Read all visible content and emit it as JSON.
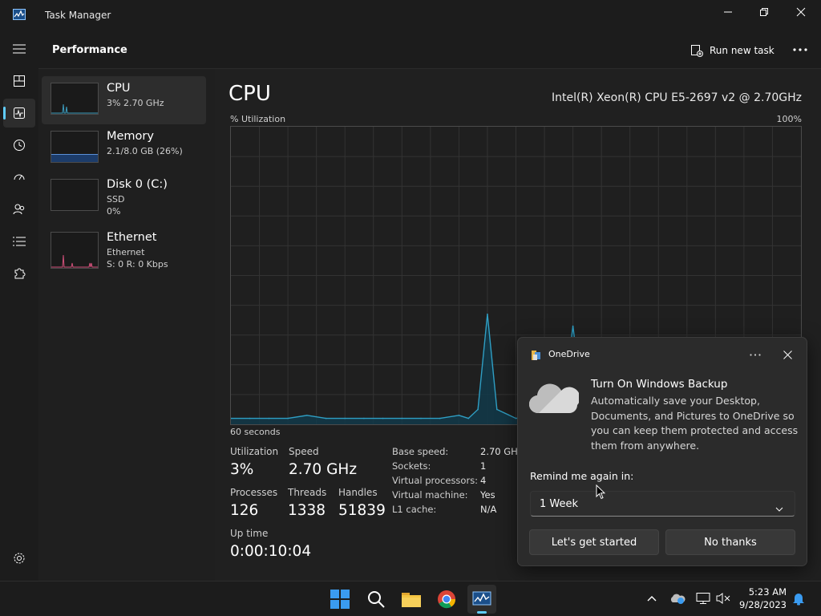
{
  "window": {
    "title": "Task Manager"
  },
  "header": {
    "page_title": "Performance",
    "run_new_task_label": "Run new task"
  },
  "devices": [
    {
      "name": "CPU",
      "sub1": "3% 2.70 GHz",
      "sub2": "",
      "sub3": "",
      "graph_color": "#3c9dbf"
    },
    {
      "name": "Memory",
      "sub1": "2.1/8.0 GB (26%)",
      "sub2": "",
      "sub3": "",
      "graph_color": "#5a8fd8",
      "usage_fraction": 0.26
    },
    {
      "name": "Disk 0 (C:)",
      "sub1": "SSD",
      "sub2": "0%",
      "sub3": "",
      "graph_color": "#6ab04c"
    },
    {
      "name": "Ethernet",
      "sub1": "Ethernet",
      "sub2": "S: 0 R: 0 Kbps",
      "sub3": "",
      "graph_color": "#d1507a"
    }
  ],
  "cpu": {
    "title": "CPU",
    "model": "Intel(R) Xeon(R) CPU E5-2697 v2 @ 2.70GHz",
    "y_label": "% Utilization",
    "y_max_label": "100%",
    "x_label": "60 seconds"
  },
  "stats": {
    "utilization_label": "Utilization",
    "utilization": "3%",
    "speed_label": "Speed",
    "speed": "2.70 GHz",
    "processes_label": "Processes",
    "processes": "126",
    "threads_label": "Threads",
    "threads": "1338",
    "handles_label": "Handles",
    "handles": "51839",
    "uptime_label": "Up time",
    "uptime": "0:00:10:04"
  },
  "specs": [
    {
      "label": "Base speed:",
      "value": "2.70 GHz"
    },
    {
      "label": "Sockets:",
      "value": "1"
    },
    {
      "label": "Virtual processors:",
      "value": "4"
    },
    {
      "label": "Virtual machine:",
      "value": "Yes"
    },
    {
      "label": "L1 cache:",
      "value": "N/A"
    }
  ],
  "chart_data": {
    "type": "area",
    "ylabel": "% Utilization",
    "xlabel": "60 seconds",
    "ylim": [
      0,
      100
    ],
    "grid": true,
    "x": [
      60,
      58,
      56,
      54,
      52,
      50,
      48,
      46,
      44,
      42,
      40,
      38,
      36,
      35,
      34,
      33,
      32,
      30,
      28,
      26,
      25,
      24,
      23,
      22,
      21.5,
      20,
      18,
      16,
      14,
      12
    ],
    "values": [
      2,
      2,
      2,
      2,
      3,
      2,
      2,
      2,
      2,
      2,
      2,
      2,
      3,
      2,
      5,
      37,
      5,
      2,
      3,
      3,
      8,
      33,
      8,
      2,
      2,
      2,
      2,
      2,
      2,
      2
    ]
  },
  "toast": {
    "app_name": "OneDrive",
    "heading": "Turn On Windows Backup",
    "body": "Automatically save your Desktop, Documents, and Pictures to OneDrive so you can keep them protected and access them from anywhere.",
    "remind_label": "Remind me again in:",
    "remind_value": "1 Week",
    "primary_button": "Let's get started",
    "secondary_button": "No thanks"
  },
  "clock": {
    "time": "5:23 AM",
    "date": "9/28/2023"
  },
  "colors": {
    "accent": "#60cdff",
    "cpu_line": "#2f9fc4",
    "background": "#202020"
  }
}
